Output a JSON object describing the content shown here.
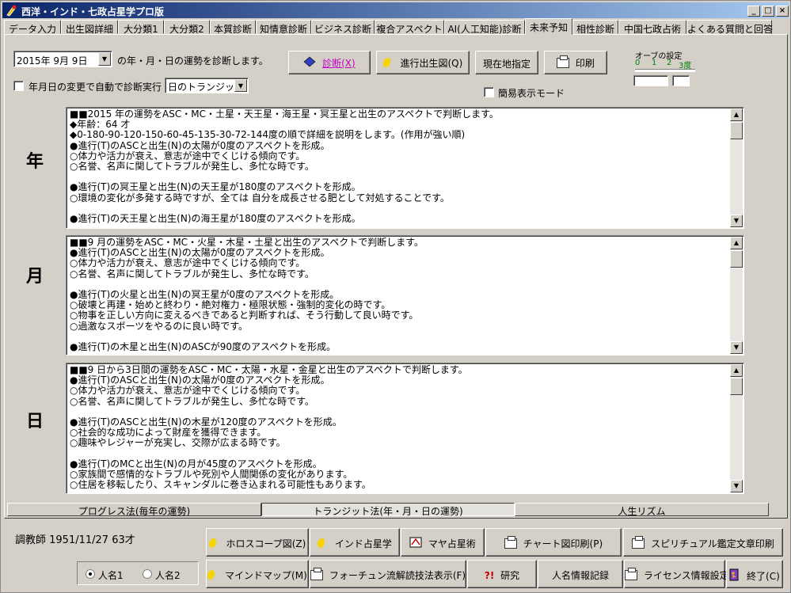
{
  "window": {
    "title": "西洋・インド・七政占星学プロ版",
    "controls": [
      "_",
      "□",
      "×"
    ]
  },
  "tabs": [
    {
      "label": "データ入力"
    },
    {
      "label": "出生図詳細"
    },
    {
      "label": "大分類1"
    },
    {
      "label": "大分類2"
    },
    {
      "label": "本質診断"
    },
    {
      "label": "知情意診断"
    },
    {
      "label": "ビジネス診断"
    },
    {
      "label": "複合アスペクト"
    },
    {
      "label": "AI(人工知能)診断"
    },
    {
      "label": "未来予知"
    },
    {
      "label": "相性診断"
    },
    {
      "label": "中国七政占術"
    },
    {
      "label": "よくある質問と回答"
    }
  ],
  "active_tab": "未来予知",
  "date_picker": {
    "value": "2015年  9月  9日"
  },
  "date_caption": "の年・月・日の運勢を診断します。",
  "auto_run": {
    "label": "年月日の変更で自動で診断実行",
    "checked": false
  },
  "transit_select": {
    "value": "日のトランジット"
  },
  "buttons": {
    "diagnose": "診断(X)",
    "progressed_chart": "進行出生図(Q)",
    "current_location": "現在地指定",
    "print": "印刷"
  },
  "simple_mode": {
    "label": "簡易表示モード",
    "checked": false
  },
  "orb": {
    "title": "オーブの設定",
    "scale": [
      "0",
      "1",
      "2",
      "3度"
    ],
    "value1": "",
    "value2": ""
  },
  "sections": {
    "year": {
      "label": "年",
      "lines": [
        "■■2015 年の運勢をASC・MC・土星・天王星・海王星・冥王星と出生のアスペクトで判断します。",
        "◆年齢：64 才",
        "◆0-180-90-120-150-60-45-135-30-72-144度の順で詳細を説明をします。(作用が強い順)",
        "●進行(T)のASCと出生(N)の太陽が0度のアスペクトを形成。",
        "○体力や活力が衰え、意志が途中でくじける傾向です。",
        "○名誉、名声に関してトラブルが発生し、多忙な時です。",
        "",
        "●進行(T)の冥王星と出生(N)の天王星が180度のアスペクトを形成。",
        "○環境の変化が多発する時ですが、全ては 自分を成長させる肥として対処することです。",
        "",
        "●進行(T)の天王星と出生(N)の海王星が180度のアスペクトを形成。"
      ]
    },
    "month": {
      "label": "月",
      "lines": [
        "■■9 月の運勢をASC・MC・火星・木星・土星と出生のアスペクトで判断します。",
        "●進行(T)のASCと出生(N)の太陽が0度のアスペクトを形成。",
        "○体力や活力が衰え、意志が途中でくじける傾向です。",
        "○名誉、名声に関してトラブルが発生し、多忙な時です。",
        "",
        "●進行(T)の火星と出生(N)の冥王星が0度のアスペクトを形成。",
        "○破壊と再建・始めと終わり・絶対権力・極限状態・強制的変化の時です。",
        "○物事を正しい方向に変えるべきであると判断すれば、そう行動して良い時です。",
        "○過激なスポーツをやるのに良い時です。",
        "",
        "●進行(T)の木星と出生(N)のASCが90度のアスペクトを形成。"
      ]
    },
    "day": {
      "label": "日",
      "lines": [
        "■■9 日から3日間の運勢をASC・MC・太陽・水星・金星と出生のアスペクトで判断します。",
        "●進行(T)のASCと出生(N)の太陽が0度のアスペクトを形成。",
        "○体力や活力が衰え、意志が途中でくじける傾向です。",
        "○名誉、名声に関してトラブルが発生し、多忙な時です。",
        "",
        "●進行(T)のASCと出生(N)の木星が120度のアスペクトを形成。",
        "○社会的な成功によって財産を獲得できます。",
        "○趣味やレジャーが充実し、交際が広まる時です。",
        "",
        "●進行(T)のMCと出生(N)の月が45度のアスペクトを形成。",
        "○家族間で感情的なトラブルや死別や人間関係の変化があります。",
        "○住居を移転したり、スキャンダルに巻き込まれる可能性もあります。"
      ]
    }
  },
  "bottom_tabs": [
    {
      "label": "プログレス法(毎年の運勢)"
    },
    {
      "label": "トランジット法(年・月・日の運勢)"
    },
    {
      "label": "人生リズム"
    }
  ],
  "active_bottom_tab": "トランジット法(年・月・日の運勢)",
  "person": {
    "info": "調教師  1951/11/27  63才"
  },
  "radios": [
    {
      "label": "人名1",
      "checked": true
    },
    {
      "label": "人名2",
      "checked": false
    }
  ],
  "footer_buttons": {
    "horoscope": "ホロスコープ図(Z)",
    "indian": "インド占星学",
    "maya": "マヤ占星術",
    "chart_print": "チャート図印刷(P)",
    "spiritual_print": "スピリチュアル鑑定文章印刷",
    "mindmap": "マインドマップ(M)",
    "fortune": "フォーチュン流解読技法表示(F)",
    "research": "研究",
    "name_record": "人名情報記録",
    "license": "ライセンス情報設定",
    "exit": "終了(C)"
  }
}
